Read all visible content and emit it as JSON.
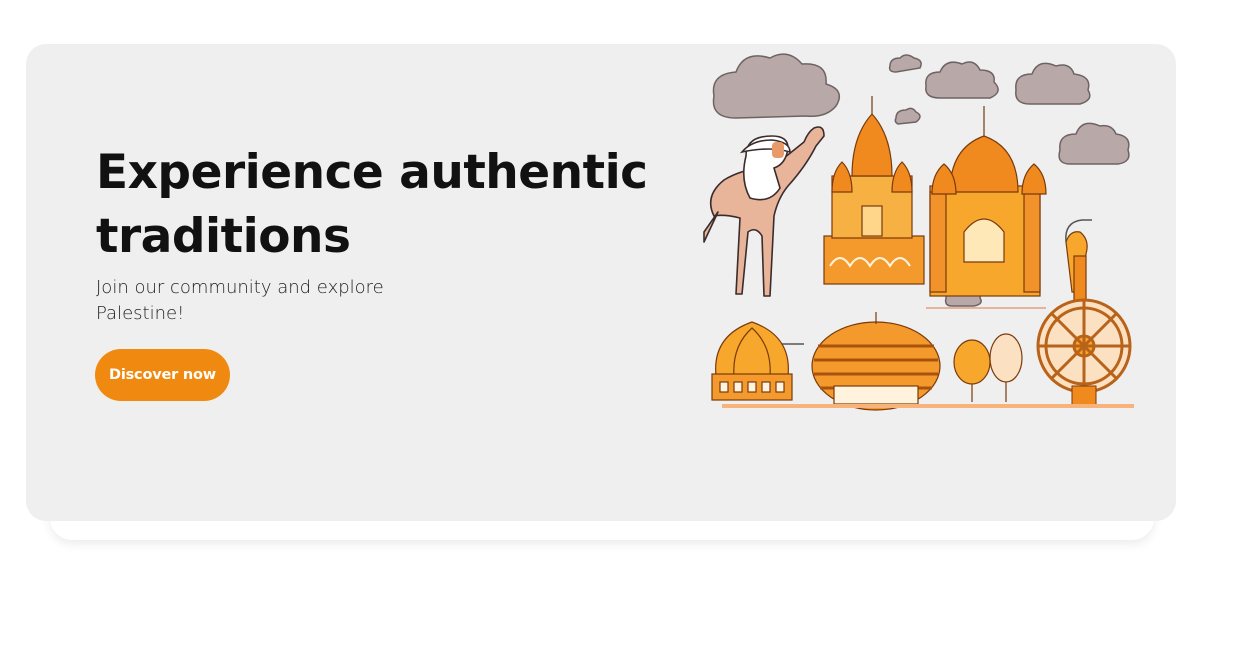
{
  "hero": {
    "title": "Experience authentic traditions",
    "subtitle": "Join our community and explore Palestine!",
    "cta_label": "Discover now",
    "illustration_icon": "palestinian-landmarks-illustration"
  },
  "colors": {
    "card_background": "#efefef",
    "accent": "#f0890f",
    "title_text": "#111111",
    "subtitle_text": "#222222"
  }
}
